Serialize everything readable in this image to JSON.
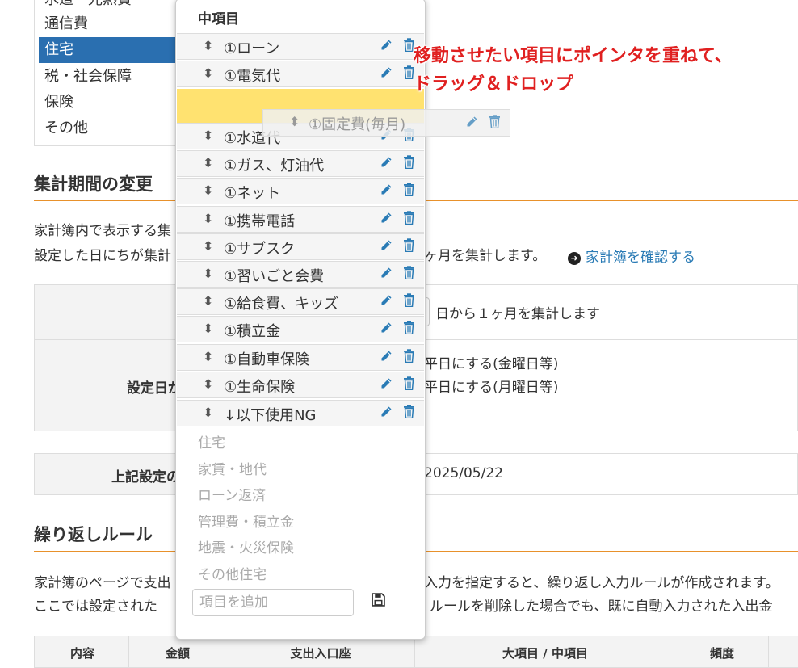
{
  "categories": {
    "items": [
      {
        "label": "水道・光熱費"
      },
      {
        "label": "通信費"
      },
      {
        "label": "住宅"
      },
      {
        "label": "税・社会保障"
      },
      {
        "label": "保険"
      },
      {
        "label": "その他"
      }
    ],
    "active_index": 2
  },
  "period_section": {
    "title": "集計期間の変更",
    "desc_line1": "家計簿内で表示する集",
    "desc_line2": "設定した日にちが集計",
    "desc_line2_tail": "ヶ月を集計します。",
    "link_label": "家計簿を確認する",
    "table": {
      "row1_text": "日から１ヶ月を集計します",
      "row2_header": "設定日が",
      "row2_option1": "平日にする(金曜日等)",
      "row2_option2": "平日にする(月曜日等)",
      "row3_header": "上記設定の",
      "row3_value": "2025/05/22"
    }
  },
  "repeat_section": {
    "title": "繰り返しルール",
    "desc_line1_left": "家計簿のページで支出",
    "desc_line1_right": "入力を指定すると、繰り返し入力ルールが作成されます。",
    "desc_line2_left": "ここでは設定された",
    "desc_line2_right": "ルールを削除した場合でも、既に自動入力された入出金",
    "table_headers": [
      "内容",
      "金額",
      "支出入口座",
      "大項目 / 中項目",
      "頻度"
    ]
  },
  "popup": {
    "title": "中項目",
    "sortable_items": [
      {
        "label": "①ローン"
      },
      {
        "label": "①電気代"
      },
      {
        "label": "①水道代"
      },
      {
        "label": "①ガス、灯油代"
      },
      {
        "label": "①ネット"
      },
      {
        "label": "①携帯電話"
      },
      {
        "label": "①サブスク"
      },
      {
        "label": "①習いごと会費"
      },
      {
        "label": "①給食費、キッズ"
      },
      {
        "label": "①積立金"
      },
      {
        "label": "①自動車保険"
      },
      {
        "label": "①生命保険"
      },
      {
        "label": "↓以下使用NG"
      }
    ],
    "fixed_items": [
      {
        "label": "住宅"
      },
      {
        "label": "家賃・地代"
      },
      {
        "label": "ローン返済"
      },
      {
        "label": "管理費・積立金"
      },
      {
        "label": "地震・火災保険"
      },
      {
        "label": "その他住宅"
      }
    ],
    "add_placeholder": "項目を追加",
    "dragging_item": {
      "label": "①固定費(毎月)"
    },
    "placeholder_color": "#ffe270"
  },
  "annotation": {
    "line1": "移動させたい項目にポインタを重ねて、",
    "line2": "ドラッグ＆ドロップ",
    "color": "#e02020"
  },
  "colors": {
    "accent_orange": "#e8912b",
    "active_blue": "#2a6fb0",
    "link_blue": "#2a7bb5",
    "icon_blue": "#2a7bb5"
  },
  "icons": {
    "drag": "sort-handle-icon",
    "edit": "pencil-icon",
    "delete": "trash-icon",
    "save": "floppy-disk-icon",
    "link": "circle-arrow-right-icon"
  }
}
